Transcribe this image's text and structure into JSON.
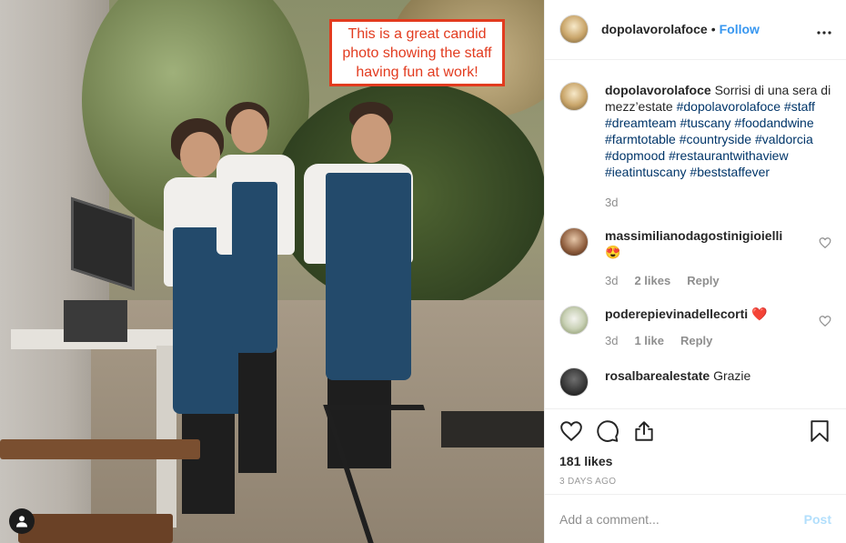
{
  "photo": {
    "annotation": "This is a great candid photo showing the staff having fun at work!",
    "user_tag_icon": "user-icon"
  },
  "header": {
    "username": "dopolavorolafoce",
    "separator": "•",
    "follow_label": "Follow",
    "more_icon": "more-horizontal-icon"
  },
  "caption": {
    "username": "dopolavorolafoce",
    "text": "Sorrisi di una sera di mezz’estate",
    "hashtags": [
      "#dopolavorolafoce",
      "#staff",
      "#dreamteam",
      "#tuscany",
      "#foodandwine",
      "#farmtotable",
      "#countryside",
      "#valdorcia",
      "#dopmood",
      "#restaurantwithaview",
      "#ieatintuscany",
      "#beststaffever"
    ],
    "age": "3d"
  },
  "comments": [
    {
      "username": "massimilianodagostinigioielli",
      "text": "😍",
      "age": "3d",
      "likes": "2 likes",
      "reply": "Reply"
    },
    {
      "username": "poderepievinadellecorti",
      "text": "❤️",
      "age": "3d",
      "likes": "1 like",
      "reply": "Reply"
    },
    {
      "username": "rosalbarealestate",
      "text": "Grazie"
    }
  ],
  "actions": {
    "like_icon": "heart-icon",
    "comment_icon": "comment-icon",
    "share_icon": "share-icon",
    "save_icon": "bookmark-icon",
    "likes": "181 likes",
    "posted": "3 DAYS AGO"
  },
  "add_comment": {
    "placeholder": "Add a comment...",
    "post_label": "Post"
  }
}
